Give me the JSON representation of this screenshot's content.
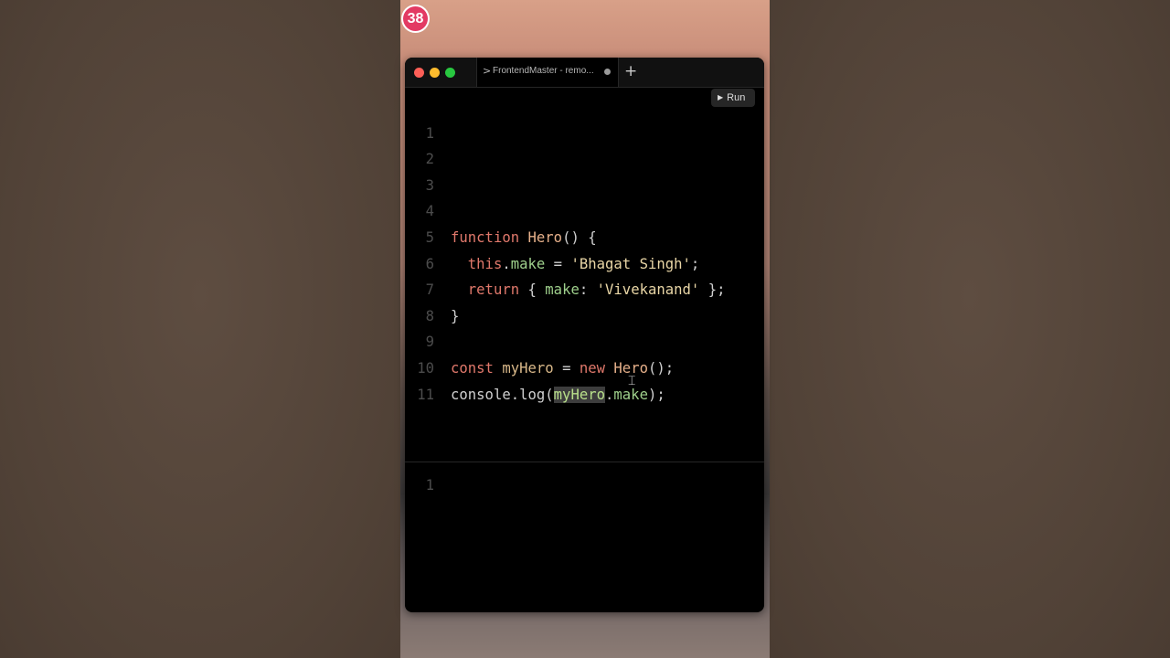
{
  "badge": {
    "text": "38"
  },
  "colors": {
    "accent": "#e33a63",
    "window_bg": "#000000"
  },
  "window": {
    "tab": {
      "label": "FrontendMaster - remo...",
      "chevron": ">"
    },
    "add_tab_symbol": "+",
    "run_button": {
      "label": "Run",
      "icon": "play-icon",
      "symbol": "▶"
    }
  },
  "editor": {
    "line_numbers": [
      "1",
      "2",
      "3",
      "4",
      "5",
      "6",
      "7",
      "8",
      "9",
      "10",
      "11"
    ],
    "tokens": {
      "l4": [
        "function",
        " ",
        "Hero",
        "() {"
      ],
      "l5": [
        "  ",
        "this",
        ".",
        "make",
        " = ",
        "'Bhagat Singh'",
        ";"
      ],
      "l6": [
        "  ",
        "return",
        " { ",
        "make",
        ": ",
        "'Vivekanand'",
        " };"
      ],
      "l7": [
        "}"
      ],
      "l9": [
        "const",
        " ",
        "myHero",
        " = ",
        "new",
        " ",
        "Hero",
        "();"
      ],
      "l10": [
        "console",
        ".",
        "log",
        "(",
        "myHero",
        ".",
        "make",
        ");"
      ]
    }
  },
  "output": {
    "line_numbers": [
      "1"
    ]
  },
  "cursor": {
    "glyph": "⌶"
  }
}
